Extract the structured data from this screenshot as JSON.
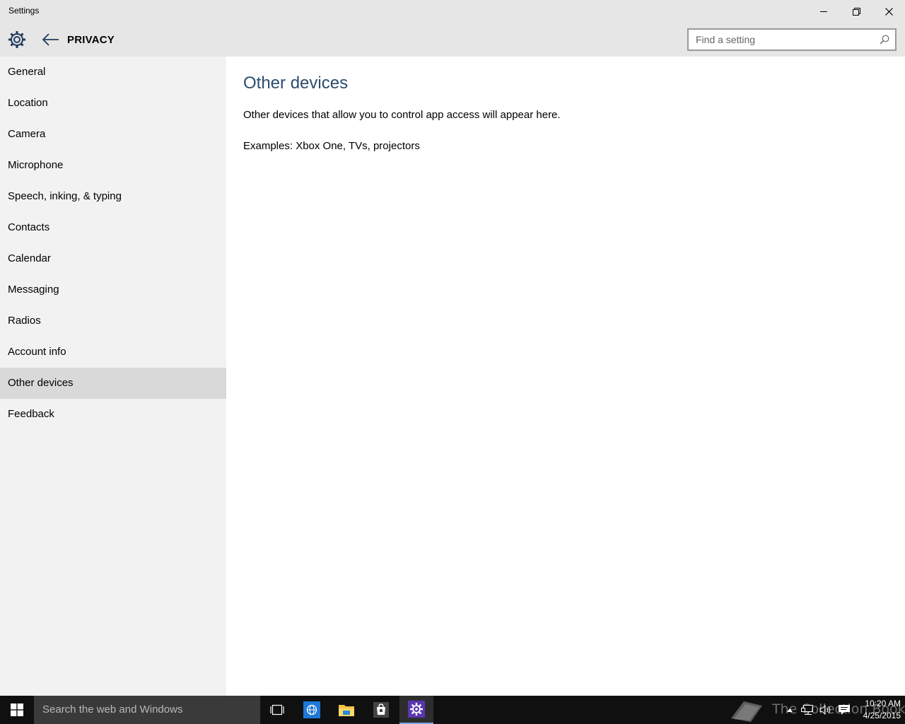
{
  "window": {
    "title": "Settings"
  },
  "header": {
    "section_title": "PRIVACY",
    "search_placeholder": "Find a setting"
  },
  "sidebar": {
    "items": [
      {
        "label": "General"
      },
      {
        "label": "Location"
      },
      {
        "label": "Camera"
      },
      {
        "label": "Microphone"
      },
      {
        "label": "Speech, inking, & typing"
      },
      {
        "label": "Contacts"
      },
      {
        "label": "Calendar"
      },
      {
        "label": "Messaging"
      },
      {
        "label": "Radios"
      },
      {
        "label": "Account info"
      },
      {
        "label": "Other devices",
        "selected": true
      },
      {
        "label": "Feedback"
      }
    ]
  },
  "main": {
    "title": "Other devices",
    "description": "Other devices that allow you to control app access will appear here.",
    "examples": "Examples: Xbox One, TVs, projectors"
  },
  "taskbar": {
    "search_placeholder": "Search the web and Windows",
    "watermark": "The Collection Book",
    "time": "10:20 AM",
    "date": "4/25/2015",
    "pinned": [
      "task-view-icon",
      "internet-explorer-icon",
      "file-explorer-icon",
      "store-icon",
      "settings-icon"
    ]
  },
  "colors": {
    "accent_title": "#2b4c6f",
    "sidebar_bg": "#f2f2f2",
    "selected_bg": "#d9d9d9",
    "header_bg": "#e6e6e6",
    "taskbar_bg": "#101010"
  }
}
